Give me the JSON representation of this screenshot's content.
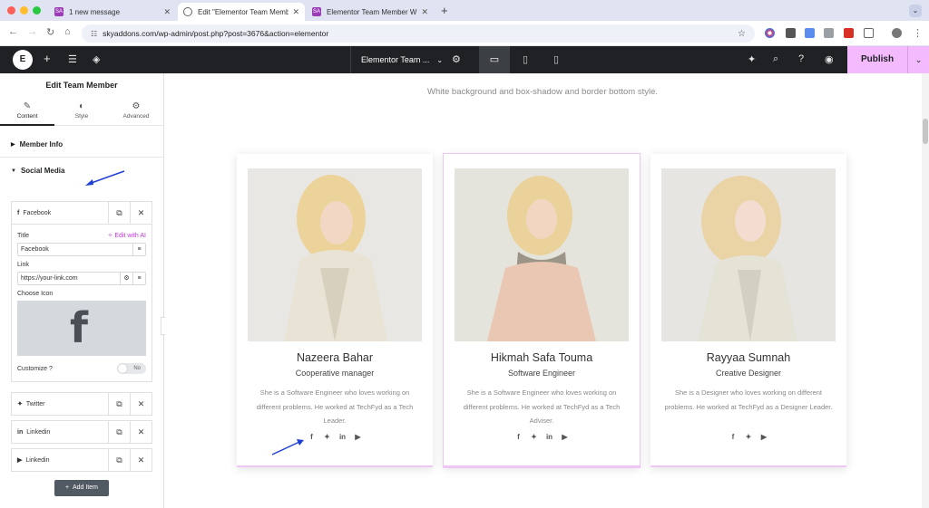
{
  "browser": {
    "tabs": [
      {
        "title": "1 new message",
        "favicon": "SA",
        "favicon_color": "#9b3bb5"
      },
      {
        "title": "Edit \"Elementor Team Member\"",
        "favicon": "",
        "favicon_color": "#555555"
      },
      {
        "title": "Elementor Team Member Wid",
        "favicon": "SA",
        "favicon_color": "#9b3bb5"
      }
    ],
    "url": "skyaddons.com/wp-admin/post.php?post=3676&action=elementor",
    "new_tab": "+"
  },
  "topbar": {
    "logo": "E",
    "document_name": "Elementor Team ...",
    "publish_label": "Publish"
  },
  "panel": {
    "title": "Edit Team Member",
    "tabs": [
      {
        "label": "Content",
        "icon": "pencil-icon"
      },
      {
        "label": "Style",
        "icon": "half-circle-icon"
      },
      {
        "label": "Advanced",
        "icon": "gear-icon"
      }
    ],
    "sections": {
      "member_info": "Member Info",
      "social_media": "Social Media"
    },
    "facebook": {
      "header": "Facebook",
      "title_label": "Title",
      "edit_ai": "Edit with AI",
      "title_value": "Facebook",
      "link_label": "Link",
      "link_value": "https://your-link.com",
      "icon_label": "Choose Icon",
      "customize_label": "Customize ?",
      "toggle_label": "No"
    },
    "items": [
      "Twitter",
      "Linkedin",
      "Linkedin"
    ],
    "add_item": "Add Item"
  },
  "canvas": {
    "subtitle": "White background and box-shadow and border bottom style.",
    "accent_color": "#f0c6f7",
    "cards": [
      {
        "name": "Nazeera Bahar",
        "role": "Cooperative manager",
        "desc": "She is a Software Engineer who loves working on different problems. He worked at TechFyd as a Tech Leader.",
        "socials": [
          "f",
          "t",
          "in",
          "yt"
        ]
      },
      {
        "name": "Hikmah Safa Touma",
        "role": "Software Engineer",
        "desc": "She is a Software Engineer who loves working on different problems. He worked at TechFyd as a Tech Adviser.",
        "socials": [
          "f",
          "t",
          "in",
          "yt"
        ]
      },
      {
        "name": "Rayyaa Sumnah",
        "role": "Creative Designer",
        "desc": "She is a Designer who loves working on different problems. He worked at TechFyd as a Designer Leader.",
        "socials": [
          "f",
          "t",
          "yt"
        ]
      }
    ]
  }
}
